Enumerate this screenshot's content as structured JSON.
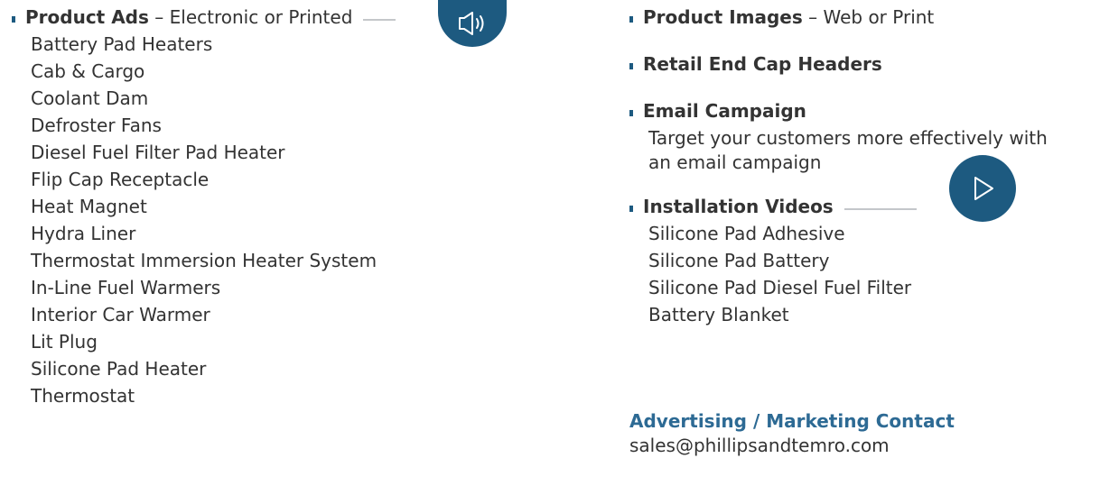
{
  "product_ads": {
    "title": "Product Ads",
    "subtitle": "– Electronic or Printed",
    "icon": "megaphone-icon",
    "items": [
      "Battery Pad Heaters",
      "Cab & Cargo",
      "Coolant Dam",
      "Defroster Fans",
      "Diesel Fuel Filter Pad Heater",
      "Flip Cap Receptacle",
      "Heat Magnet",
      "Hydra Liner",
      "Thermostat Immersion Heater System",
      "In-Line Fuel Warmers",
      "Interior Car Warmer",
      "Lit Plug",
      "Silicone Pad Heater",
      "Thermostat"
    ]
  },
  "product_images": {
    "title": "Product Images",
    "subtitle": "– Web or Print"
  },
  "retail_end_cap": {
    "title": "Retail End Cap Headers"
  },
  "email_campaign": {
    "title": "Email Campaign",
    "description_line1": "Target your customers more effectively with",
    "description_line2": "an email campaign"
  },
  "installation_videos": {
    "title": "Installation Videos",
    "icon": "play-icon",
    "items": [
      "Silicone Pad Adhesive",
      "Silicone Pad Battery",
      "Silicone Pad Diesel Fuel Filter",
      "Battery Blanket"
    ]
  },
  "contact": {
    "title": "Advertising / Marketing Contact",
    "email": "sales@phillipsandtemro.com"
  },
  "colors": {
    "accent": "#1d5a80",
    "contact_title": "#2d6a94",
    "text": "#333333",
    "rule": "#c4c7ca"
  }
}
